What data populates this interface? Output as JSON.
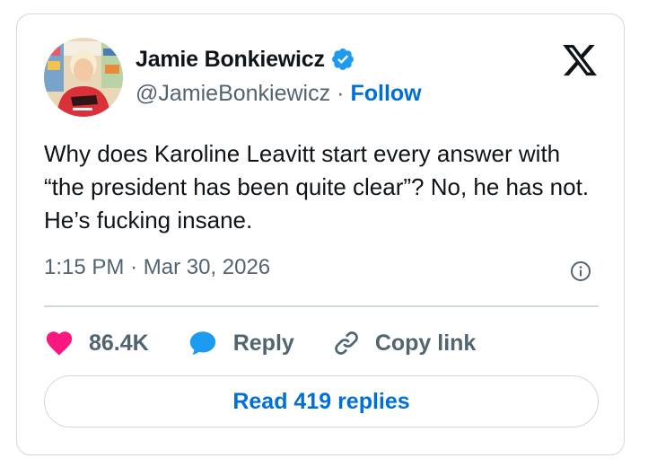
{
  "author": {
    "name": "Jamie Bonkiewicz",
    "handle": "@JamieBonkiewicz",
    "separator": "·",
    "follow_label": "Follow",
    "verified": true
  },
  "tweet": {
    "text": "Why does Karoline Leavitt start every answer with “the president has been quite clear”? No, he has not. He’s fucking insane.",
    "time": "1:15 PM",
    "separator": "·",
    "date": "Mar 30, 2026"
  },
  "actions": {
    "likes_count": "86.4K",
    "reply_label": "Reply",
    "copy_link_label": "Copy link"
  },
  "read_replies_label": "Read 419 replies",
  "icons": {
    "avatar": "avatar-photo",
    "verified": "verified-badge-icon",
    "brand": "x-logo-icon",
    "info": "info-icon",
    "like": "heart-icon",
    "reply": "speech-bubble-icon",
    "copy_link": "link-icon"
  },
  "colors": {
    "accent": "#006fd6",
    "verified": "#1d9bf0",
    "heart": "#f91880",
    "text": "#0f1419",
    "muted": "#536471",
    "border": "#cfd9de"
  }
}
